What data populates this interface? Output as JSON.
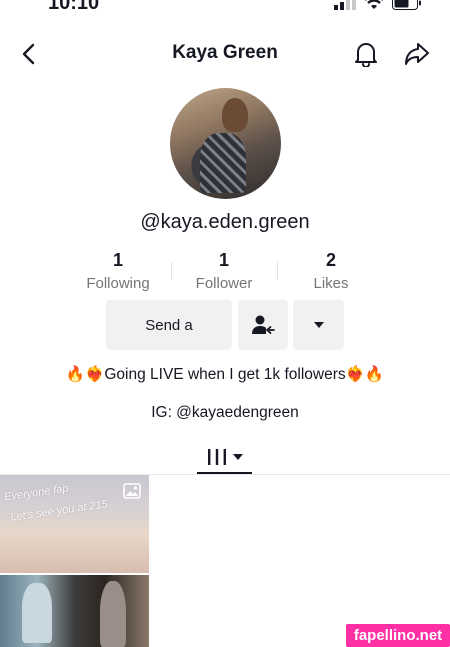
{
  "status_bar": {
    "time": "10:10"
  },
  "header": {
    "title": "Kaya Green",
    "back_icon": "chevron-left-icon",
    "bell_icon": "bell-icon",
    "share_icon": "share-arrow-icon"
  },
  "profile": {
    "username": "@kaya.eden.green",
    "stats": {
      "following_count": "1",
      "following_label": "Following",
      "follower_count": "1",
      "follower_label": "Follower",
      "likes_count": "2",
      "likes_label": "Likes"
    },
    "actions": {
      "message_label": "Send a",
      "follow_icon": "add-friend-icon",
      "more_icon": "caret-down-icon"
    },
    "bio": "🔥❤️‍🔥Going LIVE when I get 1k followers❤️‍🔥🔥",
    "ig_line": "IG: @kayaedengreen"
  },
  "tabs": {
    "videos_icon": "grid-bars-icon",
    "dropdown_icon": "caret-down-icon"
  },
  "videos": [
    {
      "caption_line1": "Everyone fap",
      "caption_line2": "Let's see you at 215",
      "type_icon": "photo-icon"
    },
    {
      "caption_line1": ""
    }
  ],
  "watermark": {
    "text": "fapellino.net"
  },
  "colors": {
    "primary_text": "#161823",
    "secondary_text": "#757575",
    "button_bg": "#f1f1f2",
    "watermark_bg": "#ff2fa5"
  }
}
